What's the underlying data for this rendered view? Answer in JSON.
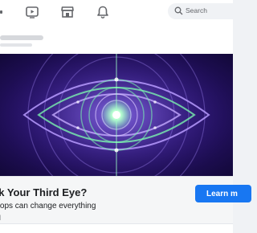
{
  "nav": {
    "icons": [
      "video-icon",
      "marketplace-icon",
      "notifications-icon"
    ],
    "search_placeholder": "Search"
  },
  "ad": {
    "headline": "ck Your Third Eye?",
    "description": "drops can change everything",
    "cta_label": "Learn m",
    "footer_fragment": "d"
  },
  "colors": {
    "accent": "#1877f2",
    "banner_dark": "#120838",
    "banner_purple": "#5a3bb0",
    "glow_green": "#7dffb0"
  }
}
